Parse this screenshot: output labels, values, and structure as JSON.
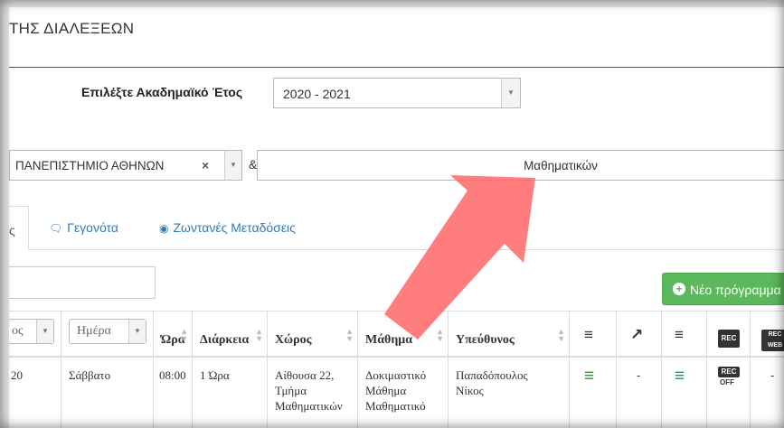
{
  "window": {
    "title": "ΤΗΣ ΔΙΑΛΕΞΕΩΝ"
  },
  "filters": {
    "year_label": "Επιλέξτε Ακαδημαϊκό Έτος",
    "year_value": "2020 - 2021",
    "institution_value": "ΠΑΝΕΠΙΣΤΗΜΙΟ ΑΘΗΝΩΝ",
    "clear_symbol": "×",
    "ampersand": "&",
    "department_value": "Μαθηματικών"
  },
  "tabs": [
    {
      "label": "ς",
      "active": true
    },
    {
      "label": "Γεγονότα",
      "icon": "events-icon"
    },
    {
      "label": "Ζωντανές Μεταδόσεις",
      "icon": "live-broadcast-icon"
    }
  ],
  "toolbar": {
    "new_button_label": "Νέο πρόγραμμα",
    "new_button_icon": "plus-circle-icon"
  },
  "table": {
    "filter_cols": [
      {
        "label": "ος"
      },
      {
        "label": "Ημέρα"
      }
    ],
    "columns": [
      "Ώρα",
      "Διάρκεια",
      "Χώρος",
      "Μάθημα",
      "Υπεύθυνος"
    ],
    "icon_columns": [
      "rss-icon",
      "share-icon",
      "rss-key-icon",
      "rec-icon",
      "rec-web-icon"
    ],
    "rec_label": "REC",
    "rec_web_label": "REC WEB",
    "rows": [
      {
        "col0": "20",
        "day": "Σάββατο",
        "time": "08:00",
        "duration": "1 Ώρα",
        "room": "Αίθουσα 22, Τμήμα Μαθηματικών",
        "course": "Δοκιμαστικό Μάθημα Μαθηματικό",
        "owner": "Παπαδόπουλος Νίκος",
        "share": "-",
        "rec_web": "-",
        "rec_state": "OFF"
      }
    ]
  },
  "colors": {
    "accent": "#337ab7",
    "success": "#5cb85c",
    "green_icon": "#1e9e3a",
    "arrow": "#ff6b6b"
  }
}
